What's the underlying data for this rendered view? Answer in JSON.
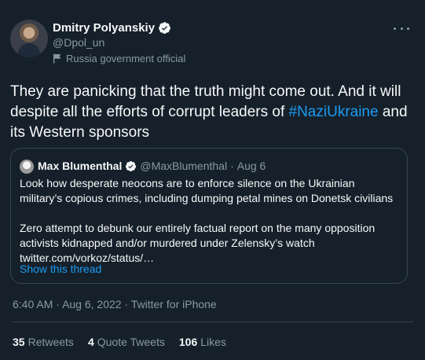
{
  "author": {
    "name": "Dmitry Polyanskiy",
    "handle": "@Dpol_un",
    "label": "Russia government official"
  },
  "tweet": {
    "text_before": "They are panicking that the truth might come out. And it will despite all the efforts of corrupt leaders of ",
    "hashtag": "#NaziUkraine",
    "text_after": " and its Western sponsors"
  },
  "quoted": {
    "name": "Max Blumenthal",
    "handle": "@MaxBlumenthal",
    "separator": "·",
    "date": "Aug 6",
    "para1": "Look how desperate neocons are to enforce silence on the Ukrainian military’s copious crimes, including dumping petal mines on Donetsk civilians",
    "para2": "Zero attempt to debunk our entirely factual report on the many opposition activists kidnapped and/or murdered under Zelensky’s watch twitter.com/vorkoz/status/…",
    "show_thread": "Show this thread"
  },
  "meta": {
    "time": "6:40 AM",
    "separator1": "·",
    "date": "Aug 6, 2022",
    "separator2": "·",
    "source": "Twitter for iPhone"
  },
  "stats": [
    {
      "count": "35",
      "label": "Retweets"
    },
    {
      "count": "4",
      "label": "Quote Tweets"
    },
    {
      "count": "106",
      "label": "Likes"
    }
  ],
  "colors": {
    "background": "#15202b",
    "accent": "#1d9bf0",
    "secondary_text": "#8b98a5",
    "border": "#38444d"
  },
  "icons": [
    "verified-badge-icon",
    "flag-icon",
    "more-icon"
  ]
}
